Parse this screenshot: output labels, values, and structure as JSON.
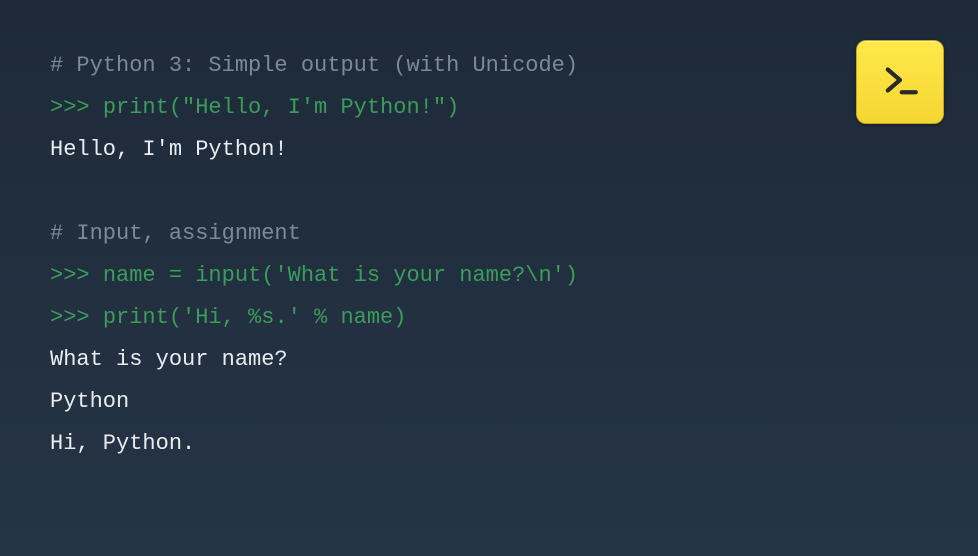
{
  "code": {
    "lines": [
      {
        "type": "comment",
        "text": "# Python 3: Simple output (with Unicode)"
      },
      {
        "type": "input",
        "prompt": ">>> ",
        "code": "print(\"Hello, I'm Python!\")"
      },
      {
        "type": "output",
        "text": "Hello, I'm Python!"
      },
      {
        "type": "empty",
        "text": ""
      },
      {
        "type": "comment",
        "text": "# Input, assignment"
      },
      {
        "type": "input",
        "prompt": ">>> ",
        "code": "name = input('What is your name?\\n')"
      },
      {
        "type": "input",
        "prompt": ">>> ",
        "code": "print('Hi, %s.' % name)"
      },
      {
        "type": "output",
        "text": "What is your name?"
      },
      {
        "type": "output",
        "text": "Python"
      },
      {
        "type": "output",
        "text": "Hi, Python."
      }
    ]
  },
  "launch_button": {
    "icon_name": "terminal-prompt-icon"
  }
}
